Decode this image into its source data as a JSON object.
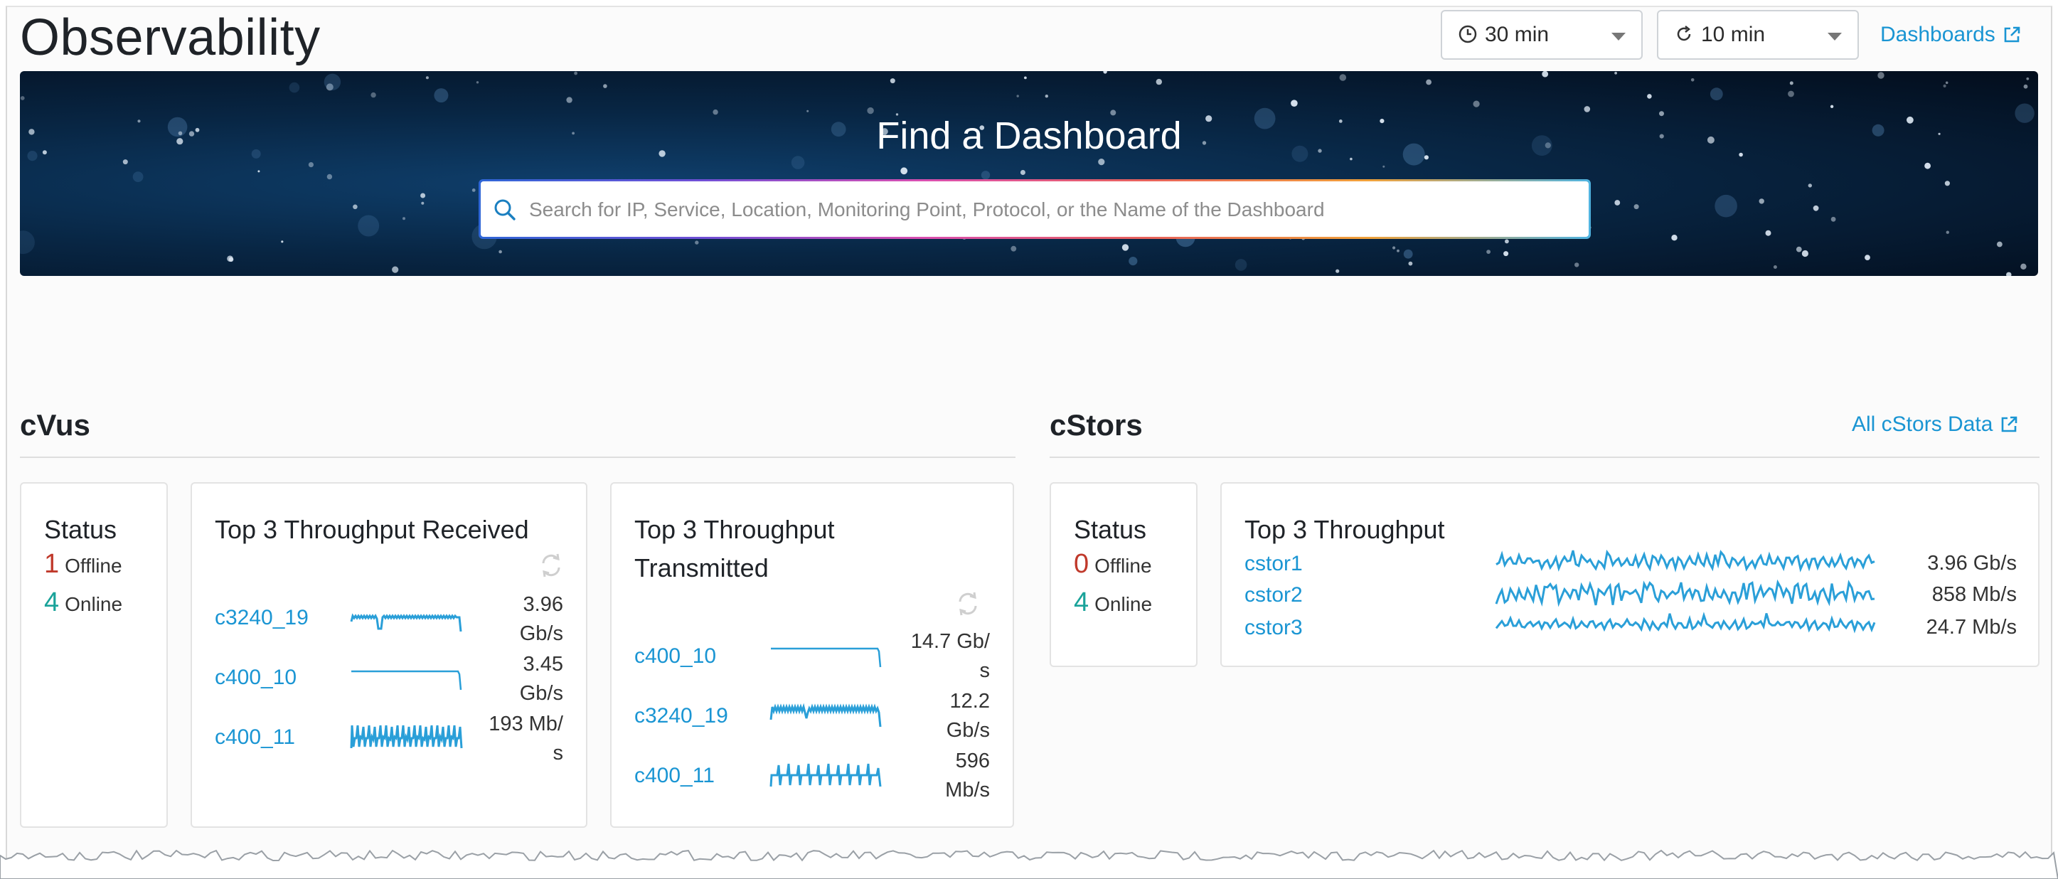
{
  "header": {
    "title": "Observability",
    "time_range": "30 min",
    "refresh_interval": "10 min",
    "dashboards_link": "Dashboards"
  },
  "banner": {
    "title": "Find a Dashboard",
    "search_placeholder": "Search for IP, Service, Location, Monitoring Point, Protocol, or the Name of the Dashboard"
  },
  "cvus": {
    "title": "cVus",
    "status": {
      "title": "Status",
      "offline_count": "1",
      "offline_label": "Offline",
      "online_count": "4",
      "online_label": "Online"
    },
    "received": {
      "title": "Top 3 Throughput Received",
      "items": [
        {
          "host": "c3240_19",
          "rate_line1": "3.96",
          "rate_line2": "Gb/s"
        },
        {
          "host": "c400_10",
          "rate_line1": "3.45",
          "rate_line2": "Gb/s"
        },
        {
          "host": "c400_11",
          "rate_line1": "193 Mb/",
          "rate_line2": "s"
        }
      ]
    },
    "transmitted": {
      "title_line1": "Top 3 Throughput",
      "title_line2": "Transmitted",
      "items": [
        {
          "host": "c400_10",
          "rate_line1": "14.7 Gb/",
          "rate_line2": "s"
        },
        {
          "host": "c3240_19",
          "rate_line1": "12.2",
          "rate_line2": "Gb/s"
        },
        {
          "host": "c400_11",
          "rate_line1": "596",
          "rate_line2": "Mb/s"
        }
      ]
    }
  },
  "cstors": {
    "title": "cStors",
    "all_link": "All cStors Data",
    "status": {
      "title": "Status",
      "offline_count": "0",
      "offline_label": "Offline",
      "online_count": "4",
      "online_label": "Online"
    },
    "throughput": {
      "title": "Top 3 Throughput",
      "items": [
        {
          "host": "cstor1",
          "rate": "3.96 Gb/s"
        },
        {
          "host": "cstor2",
          "rate": "858 Mb/s"
        },
        {
          "host": "cstor3",
          "rate": "24.7 Mb/s"
        }
      ]
    }
  },
  "colors": {
    "accent": "#1a95d3",
    "offline": "#c0392b",
    "online": "#1aa39a",
    "spark": "#2a9fd8"
  },
  "icons": {
    "time": "clock-icon",
    "refresh": "refresh-icon",
    "external": "external-link-icon",
    "search": "search-icon",
    "caret": "chevron-down-icon"
  }
}
